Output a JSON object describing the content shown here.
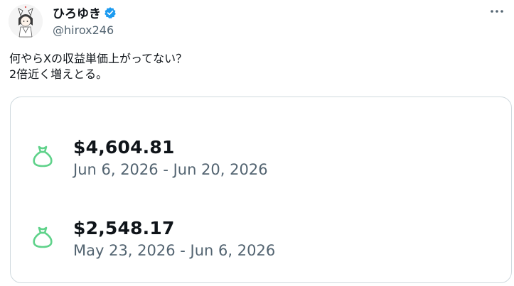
{
  "author": {
    "display_name": "ひろゆき",
    "handle": "@hirox246",
    "verified_color": "#1d9bf0"
  },
  "tweet": {
    "line1": "何やらXの収益単価上がってない？",
    "line2": "2倍近く増えとる。"
  },
  "earnings": [
    {
      "amount": "$4,604.81",
      "range": "Jun 6, 2026 - Jun 20, 2026",
      "icon": "money-bag-icon"
    },
    {
      "amount": "$2,548.17",
      "range": "May 23, 2026 - Jun 6, 2026",
      "icon": "money-bag-icon"
    }
  ],
  "colors": {
    "text": "#0f1419",
    "muted": "#536471",
    "bag": "#5fd28a",
    "border": "#cfd9de"
  }
}
